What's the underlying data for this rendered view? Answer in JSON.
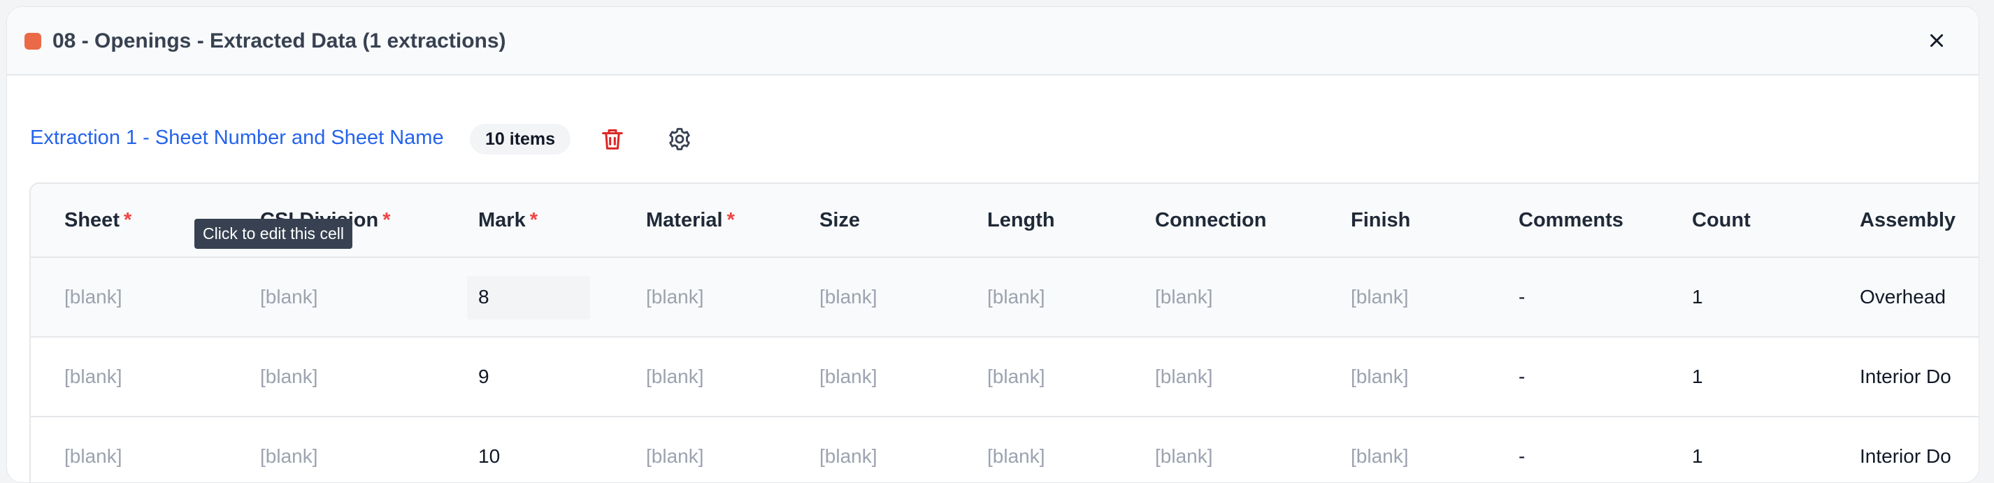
{
  "dialog": {
    "title": "08 - Openings - Extracted Data (1 extractions)",
    "accent_color": "#ea6a47",
    "close_icon": "close-icon"
  },
  "extraction": {
    "link_label": "Extraction 1 - Sheet Number and Sheet Name",
    "count_badge": "10 items",
    "delete_icon": "trash-icon",
    "settings_icon": "gear-icon"
  },
  "tooltip": "Click to edit this cell",
  "table": {
    "columns": [
      {
        "label": "Sheet",
        "required": "*"
      },
      {
        "label": "CSI Division",
        "required": "*"
      },
      {
        "label": "Mark",
        "required": "*"
      },
      {
        "label": "Material",
        "required": "*"
      },
      {
        "label": "Size",
        "required": ""
      },
      {
        "label": "Length",
        "required": ""
      },
      {
        "label": "Connection",
        "required": ""
      },
      {
        "label": "Finish",
        "required": ""
      },
      {
        "label": "Comments",
        "required": ""
      },
      {
        "label": "Count",
        "required": ""
      },
      {
        "label": "Assembly",
        "required": ""
      }
    ],
    "rows": [
      [
        "[blank]",
        "[blank]",
        "8",
        "[blank]",
        "[blank]",
        "[blank]",
        "[blank]",
        "[blank]",
        "-",
        "1",
        "Overhead"
      ],
      [
        "[blank]",
        "[blank]",
        "9",
        "[blank]",
        "[blank]",
        "[blank]",
        "[blank]",
        "[blank]",
        "-",
        "1",
        "Interior Do"
      ],
      [
        "[blank]",
        "[blank]",
        "10",
        "[blank]",
        "[blank]",
        "[blank]",
        "[blank]",
        "[blank]",
        "-",
        "1",
        "Interior Do"
      ]
    ]
  }
}
